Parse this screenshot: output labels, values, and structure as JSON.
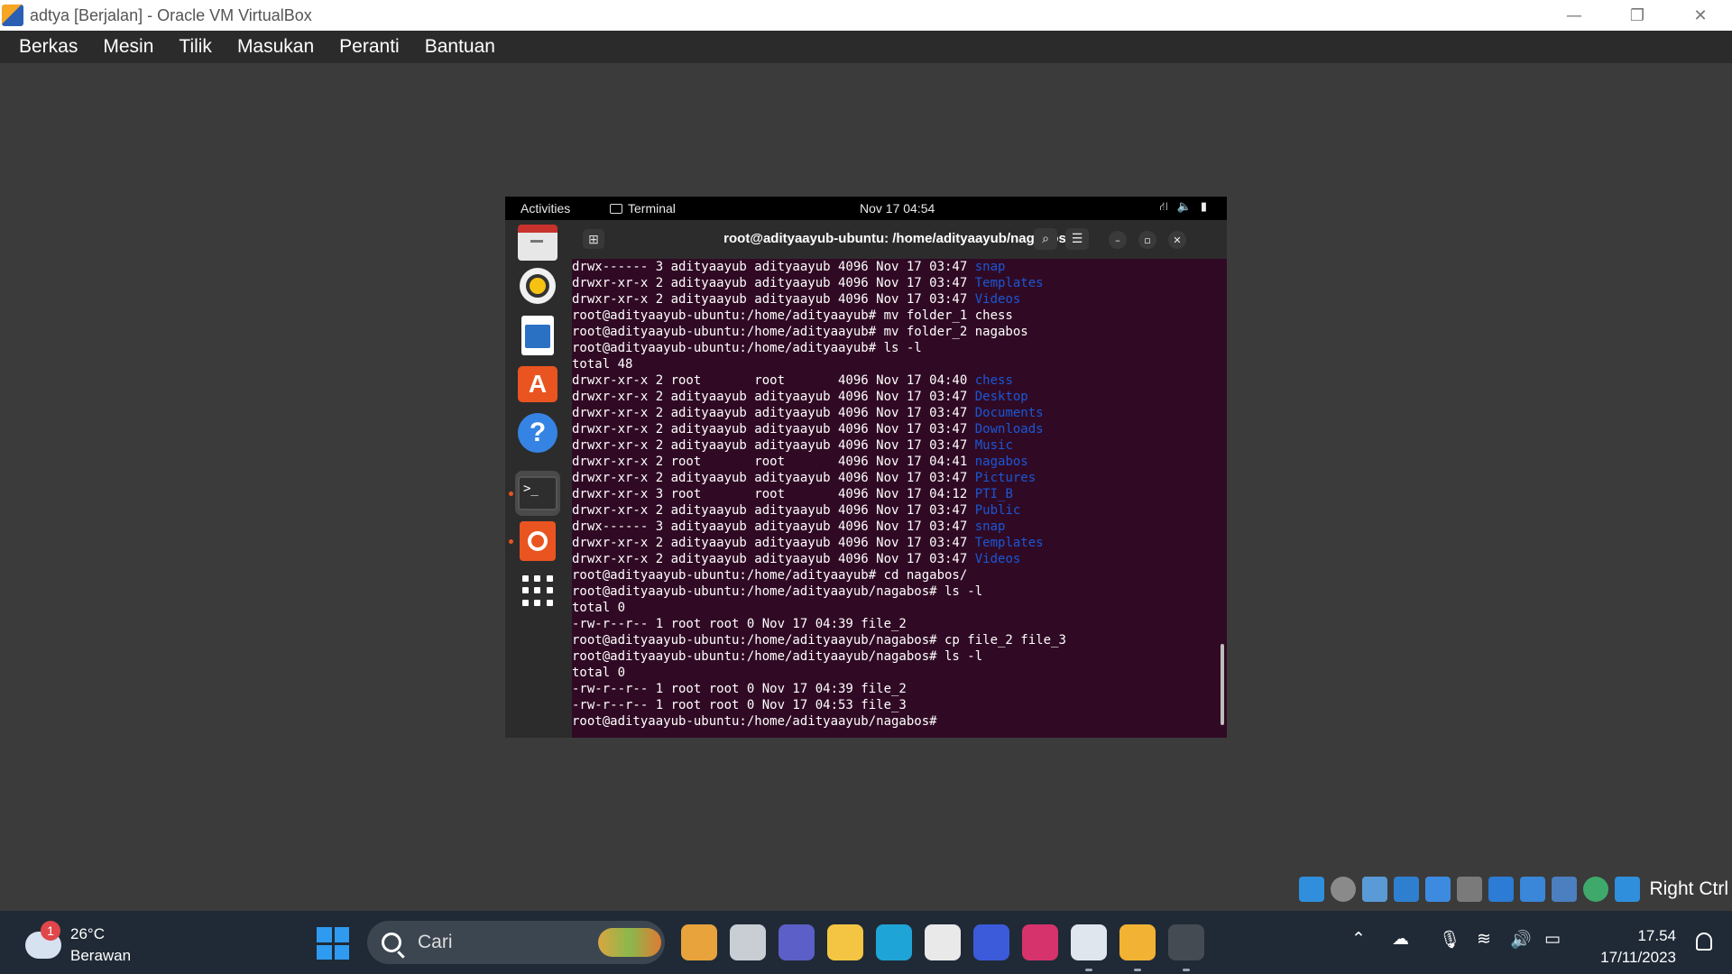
{
  "host": {
    "window_title": "adtya [Berjalan] - Oracle VM VirtualBox",
    "menu": [
      "Berkas",
      "Mesin",
      "Tilik",
      "Masukan",
      "Peranti",
      "Bantuan"
    ],
    "controls": {
      "minimize": "—",
      "restore": "❐",
      "close": "✕"
    },
    "host_key": "Right Ctrl"
  },
  "vm": {
    "topbar": {
      "activities": "Activities",
      "app": "Terminal",
      "clock": "Nov 17  04:54",
      "tray_icons": [
        "network-icon",
        "volume-icon",
        "battery-icon"
      ]
    },
    "dock": [
      "files-icon",
      "rhythmbox-icon",
      "writer-icon",
      "app-center-icon",
      "help-icon",
      "terminal-icon",
      "ubuntu-icon",
      "show-apps-icon"
    ],
    "terminal": {
      "title": "root@adityaayub-ubuntu: /home/adityaayub/nagabos",
      "lines": [
        {
          "t": "drwx------ 3 adityaayub adityaayub 4096 Nov 17 03:47 ",
          "d": "snap"
        },
        {
          "t": "drwxr-xr-x 2 adityaayub adityaayub 4096 Nov 17 03:47 ",
          "d": "Templates"
        },
        {
          "t": "drwxr-xr-x 2 adityaayub adityaayub 4096 Nov 17 03:47 ",
          "d": "Videos"
        },
        {
          "t": "root@adityaayub-ubuntu:/home/adityaayub# mv folder_1 chess",
          "d": ""
        },
        {
          "t": "root@adityaayub-ubuntu:/home/adityaayub# mv folder_2 nagabos",
          "d": ""
        },
        {
          "t": "root@adityaayub-ubuntu:/home/adityaayub# ls -l",
          "d": ""
        },
        {
          "t": "total 48",
          "d": ""
        },
        {
          "t": "drwxr-xr-x 2 root       root       4096 Nov 17 04:40 ",
          "d": "chess"
        },
        {
          "t": "drwxr-xr-x 2 adityaayub adityaayub 4096 Nov 17 03:47 ",
          "d": "Desktop"
        },
        {
          "t": "drwxr-xr-x 2 adityaayub adityaayub 4096 Nov 17 03:47 ",
          "d": "Documents"
        },
        {
          "t": "drwxr-xr-x 2 adityaayub adityaayub 4096 Nov 17 03:47 ",
          "d": "Downloads"
        },
        {
          "t": "drwxr-xr-x 2 adityaayub adityaayub 4096 Nov 17 03:47 ",
          "d": "Music"
        },
        {
          "t": "drwxr-xr-x 2 root       root       4096 Nov 17 04:41 ",
          "d": "nagabos"
        },
        {
          "t": "drwxr-xr-x 2 adityaayub adityaayub 4096 Nov 17 03:47 ",
          "d": "Pictures"
        },
        {
          "t": "drwxr-xr-x 3 root       root       4096 Nov 17 04:12 ",
          "d": "PTI_B"
        },
        {
          "t": "drwxr-xr-x 2 adityaayub adityaayub 4096 Nov 17 03:47 ",
          "d": "Public"
        },
        {
          "t": "drwx------ 3 adityaayub adityaayub 4096 Nov 17 03:47 ",
          "d": "snap"
        },
        {
          "t": "drwxr-xr-x 2 adityaayub adityaayub 4096 Nov 17 03:47 ",
          "d": "Templates"
        },
        {
          "t": "drwxr-xr-x 2 adityaayub adityaayub 4096 Nov 17 03:47 ",
          "d": "Videos"
        },
        {
          "t": "root@adityaayub-ubuntu:/home/adityaayub# cd nagabos/",
          "d": ""
        },
        {
          "t": "root@adityaayub-ubuntu:/home/adityaayub/nagabos# ls -l",
          "d": ""
        },
        {
          "t": "total 0",
          "d": ""
        },
        {
          "t": "-rw-r--r-- 1 root root 0 Nov 17 04:39 file_2",
          "d": ""
        },
        {
          "t": "root@adityaayub-ubuntu:/home/adityaayub/nagabos# cp file_2 file_3",
          "d": ""
        },
        {
          "t": "root@adityaayub-ubuntu:/home/adityaayub/nagabos# ls -l",
          "d": ""
        },
        {
          "t": "total 0",
          "d": ""
        },
        {
          "t": "-rw-r--r-- 1 root root 0 Nov 17 04:39 file_2",
          "d": ""
        },
        {
          "t": "-rw-r--r-- 1 root root 0 Nov 17 04:53 file_3",
          "d": ""
        },
        {
          "t": "root@adityaayub-ubuntu:/home/adityaayub/nagabos# ",
          "d": ""
        }
      ]
    }
  },
  "status_icons": [
    "hard-disk-icon",
    "optical-drive-icon",
    "audio-icon",
    "network-icon",
    "usb-icon",
    "shared-folder-icon",
    "display-icon",
    "recording-icon",
    "virtualization-icon",
    "mouse-integration-icon",
    "download-icon"
  ],
  "taskbar": {
    "weather": {
      "temp": "26°C",
      "desc": "Berawan",
      "badge": "1"
    },
    "search_placeholder": "Cari",
    "apps": [
      {
        "name": "copilot-icon",
        "color": "#e8a33c"
      },
      {
        "name": "task-view-icon",
        "color": "#c9ced4"
      },
      {
        "name": "teams-icon",
        "color": "#5b5fc7"
      },
      {
        "name": "file-explorer-icon",
        "color": "#f4c542"
      },
      {
        "name": "edge-icon",
        "color": "#1fa4d8"
      },
      {
        "name": "microsoft-store-icon",
        "color": "#e9e9e9"
      },
      {
        "name": "app-icon-blue",
        "color": "#3b5bdb"
      },
      {
        "name": "instagram-icon",
        "color": "#d6336c"
      },
      {
        "name": "virtualbox-icon",
        "color": "#dfe6ee"
      },
      {
        "name": "virtualbox-vm-icon",
        "color": "#f2b233"
      },
      {
        "name": "obs-icon",
        "color": "#444b52"
      }
    ],
    "time": "17.54",
    "date": "17/11/2023"
  }
}
